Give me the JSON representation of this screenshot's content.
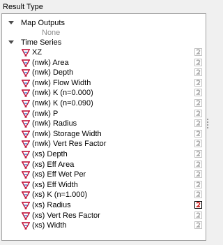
{
  "panel": {
    "title": "Result Type"
  },
  "tree": {
    "groups": [
      {
        "label": "Map Outputs",
        "expanded": true,
        "children": [
          {
            "label": "None",
            "disabled": true
          }
        ]
      },
      {
        "label": "Time Series",
        "expanded": true,
        "items": [
          {
            "label": "XZ",
            "selected": false
          },
          {
            "label": "(nwk) Area",
            "selected": false
          },
          {
            "label": "(nwk) Depth",
            "selected": false
          },
          {
            "label": "(nwk) Flow Width",
            "selected": false
          },
          {
            "label": "(nwk) K (n=0.000)",
            "selected": false
          },
          {
            "label": "(nwk) K (n=0.090)",
            "selected": false
          },
          {
            "label": "(nwk) P",
            "selected": false
          },
          {
            "label": "(nwk) Radius",
            "selected": false
          },
          {
            "label": "(nwk) Storage Width",
            "selected": false
          },
          {
            "label": "(nwk) Vert Res Factor",
            "selected": false
          },
          {
            "label": "(xs) Depth",
            "selected": false
          },
          {
            "label": "(xs) Eff Area",
            "selected": false
          },
          {
            "label": "(xs) Eff Wet Per",
            "selected": false
          },
          {
            "label": "(xs) Eff Width",
            "selected": false
          },
          {
            "label": "(xs) K (n=1.000)",
            "selected": false
          },
          {
            "label": "(xs) Radius",
            "selected": true
          },
          {
            "label": "(xs) Vert Res Factor",
            "selected": false
          },
          {
            "label": "(xs) Width",
            "selected": false
          }
        ]
      }
    ]
  },
  "icons": {
    "expand": "triangle-down-icon",
    "series": "time-series-chart-icon",
    "secondary_axis": "secondary-axis-checkbox-icon"
  },
  "colors": {
    "series_icon": "#c0143c",
    "checkbox_active": "#d21414",
    "checkbox_inactive": "#a8a8a8"
  }
}
